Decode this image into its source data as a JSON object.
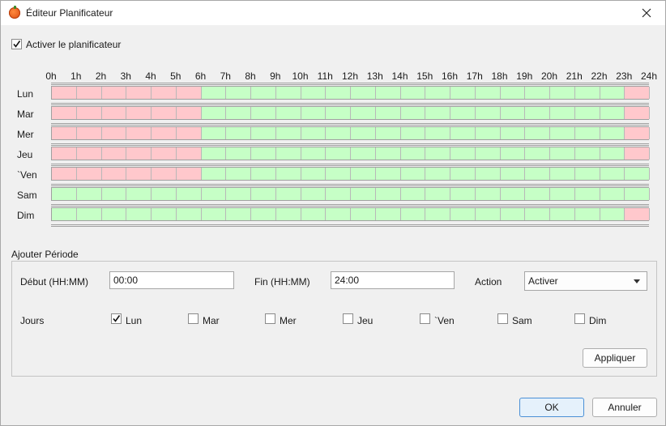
{
  "window": {
    "title": "Éditeur Planificateur"
  },
  "enable_scheduler": {
    "label": "Activer le planificateur",
    "checked": true
  },
  "hours": [
    "0h",
    "1h",
    "2h",
    "3h",
    "4h",
    "5h",
    "6h",
    "7h",
    "8h",
    "9h",
    "10h",
    "11h",
    "12h",
    "13h",
    "14h",
    "15h",
    "16h",
    "17h",
    "18h",
    "19h",
    "20h",
    "21h",
    "22h",
    "23h",
    "24h"
  ],
  "colors": {
    "inactive": "#ffc8cc",
    "active": "#c6ffc6"
  },
  "schedule": [
    {
      "day": "Lun",
      "hours": "RRRRRRGGGGGGGGGGGGGGGGGR"
    },
    {
      "day": "Mar",
      "hours": "RRRRRRGGGGGGGGGGGGGGGGGR"
    },
    {
      "day": "Mer",
      "hours": "RRRRRRGGGGGGGGGGGGGGGGGR"
    },
    {
      "day": "Jeu",
      "hours": "RRRRRRGGGGGGGGGGGGGGGGGR"
    },
    {
      "day": "`Ven",
      "hours": "RRRRRRGGGGGGGGGGGGGGGGGG"
    },
    {
      "day": "Sam",
      "hours": "GGGGGGGGGGGGGGGGGGGGGGGG"
    },
    {
      "day": "Dim",
      "hours": "GGGGGGGGGGGGGGGGGGGGGGGR"
    }
  ],
  "add_period": {
    "title": "Ajouter Période",
    "start_label": "Début (HH:MM)",
    "start_value": "00:00",
    "end_label": "Fin (HH:MM)",
    "end_value": "24:00",
    "action_label": "Action",
    "action_value": "Activer",
    "days_label": "Jours",
    "days": [
      {
        "label": "Lun",
        "checked": true
      },
      {
        "label": "Mar",
        "checked": false
      },
      {
        "label": "Mer",
        "checked": false
      },
      {
        "label": "Jeu",
        "checked": false
      },
      {
        "label": "`Ven",
        "checked": false
      },
      {
        "label": "Sam",
        "checked": false
      },
      {
        "label": "Dim",
        "checked": false
      }
    ],
    "apply_label": "Appliquer"
  },
  "footer": {
    "ok_label": "OK",
    "cancel_label": "Annuler"
  }
}
